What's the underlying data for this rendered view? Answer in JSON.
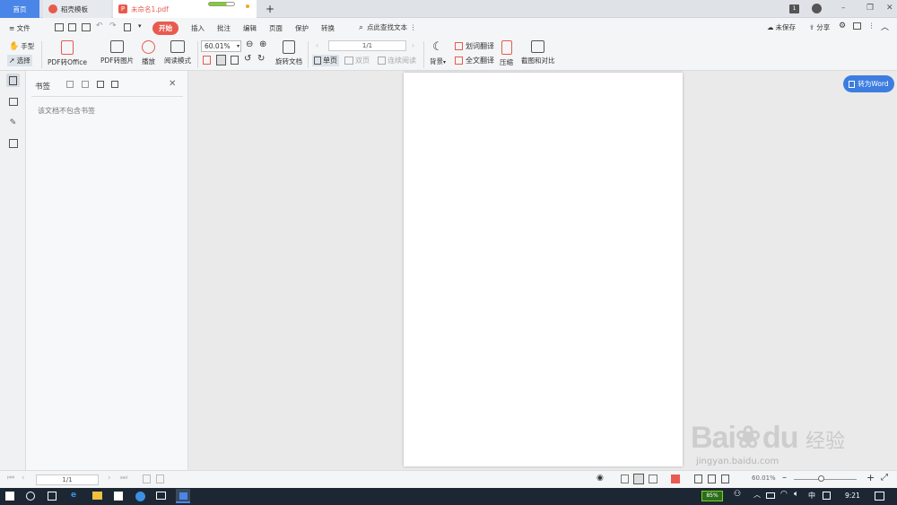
{
  "tabs": {
    "home": "首页",
    "template": "稻壳模板",
    "pdf": "未命名1.pdf",
    "new_tab": "+"
  },
  "window": {
    "badge": "1",
    "minimize": "–",
    "restore": "❐",
    "close": "✕"
  },
  "menubar": {
    "file": "≡ 文件",
    "items": [
      "开始",
      "插入",
      "批注",
      "编辑",
      "页面",
      "保护",
      "转换"
    ],
    "search": "点此查找文本",
    "unsaved": "未保存",
    "share": "分享"
  },
  "ribbon": {
    "hand": "手型",
    "select": "选择",
    "pdf_to_office": "PDF转Office",
    "pdf_to_image": "PDF转图片",
    "play": "播放",
    "read_mode": "阅读模式",
    "zoom": "60.01%",
    "rotate_doc": "旋转文档",
    "single_page": "单页",
    "double_page": "双页",
    "continuous": "连续阅读",
    "page_input": "1/1",
    "background": "背景",
    "word_translate": "划词翻译",
    "full_translate": "全文翻译",
    "compress": "压缩",
    "screenshot_compare": "截图和对比"
  },
  "panel": {
    "title": "书签",
    "empty": "该文档不包含书签"
  },
  "doc": {
    "to_word": "转为Word"
  },
  "statusbar": {
    "page": "1/1",
    "zoom": "60.01%"
  },
  "taskbar": {
    "battery": "85%",
    "ime": "中",
    "time": "9:21"
  },
  "watermark": {
    "brand": "Bai",
    "brand2": "du",
    "cn": "经验",
    "url": "jingyan.baidu.com"
  },
  "colors": {
    "accent": "#4a86e8",
    "start_tab": "#e85a4f",
    "to_word": "#3d7de0"
  }
}
